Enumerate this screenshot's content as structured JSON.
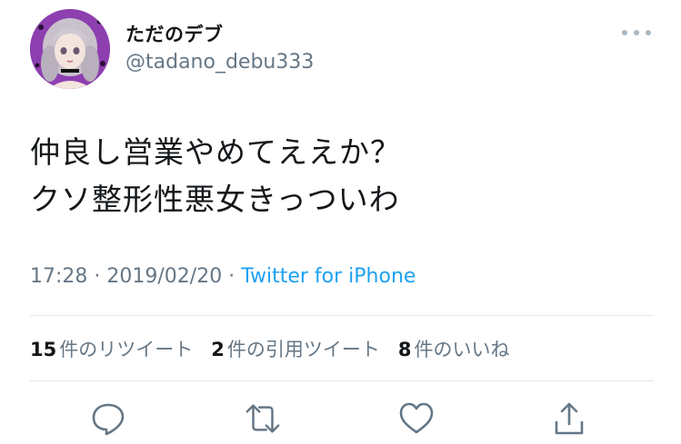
{
  "author": {
    "display_name": "ただのデブ",
    "username": "@tadano_debu333"
  },
  "tweet": {
    "lines": [
      "仲良し営業やめてええか？",
      "クソ整形性悪女きっついわ"
    ]
  },
  "meta": {
    "time": "17:28",
    "separator": " · ",
    "date": "2019/02/20",
    "separator2": " · ",
    "source": "Twitter for iPhone"
  },
  "stats": {
    "retweets_count": "15",
    "retweets_label": "件のリツイート",
    "quotes_count": "2",
    "quotes_label": "件の引用ツイート",
    "likes_count": "8",
    "likes_label": "件のいいね"
  },
  "icons": {
    "more": "more-icon",
    "reply": "reply-icon",
    "retweet": "retweet-icon",
    "like": "heart-icon",
    "share": "share-icon"
  },
  "colors": {
    "text": "#14171a",
    "secondary": "#657786",
    "link": "#1da1f2",
    "divider": "#e1e8ed",
    "avatar_bg": "#8d3fb0"
  }
}
